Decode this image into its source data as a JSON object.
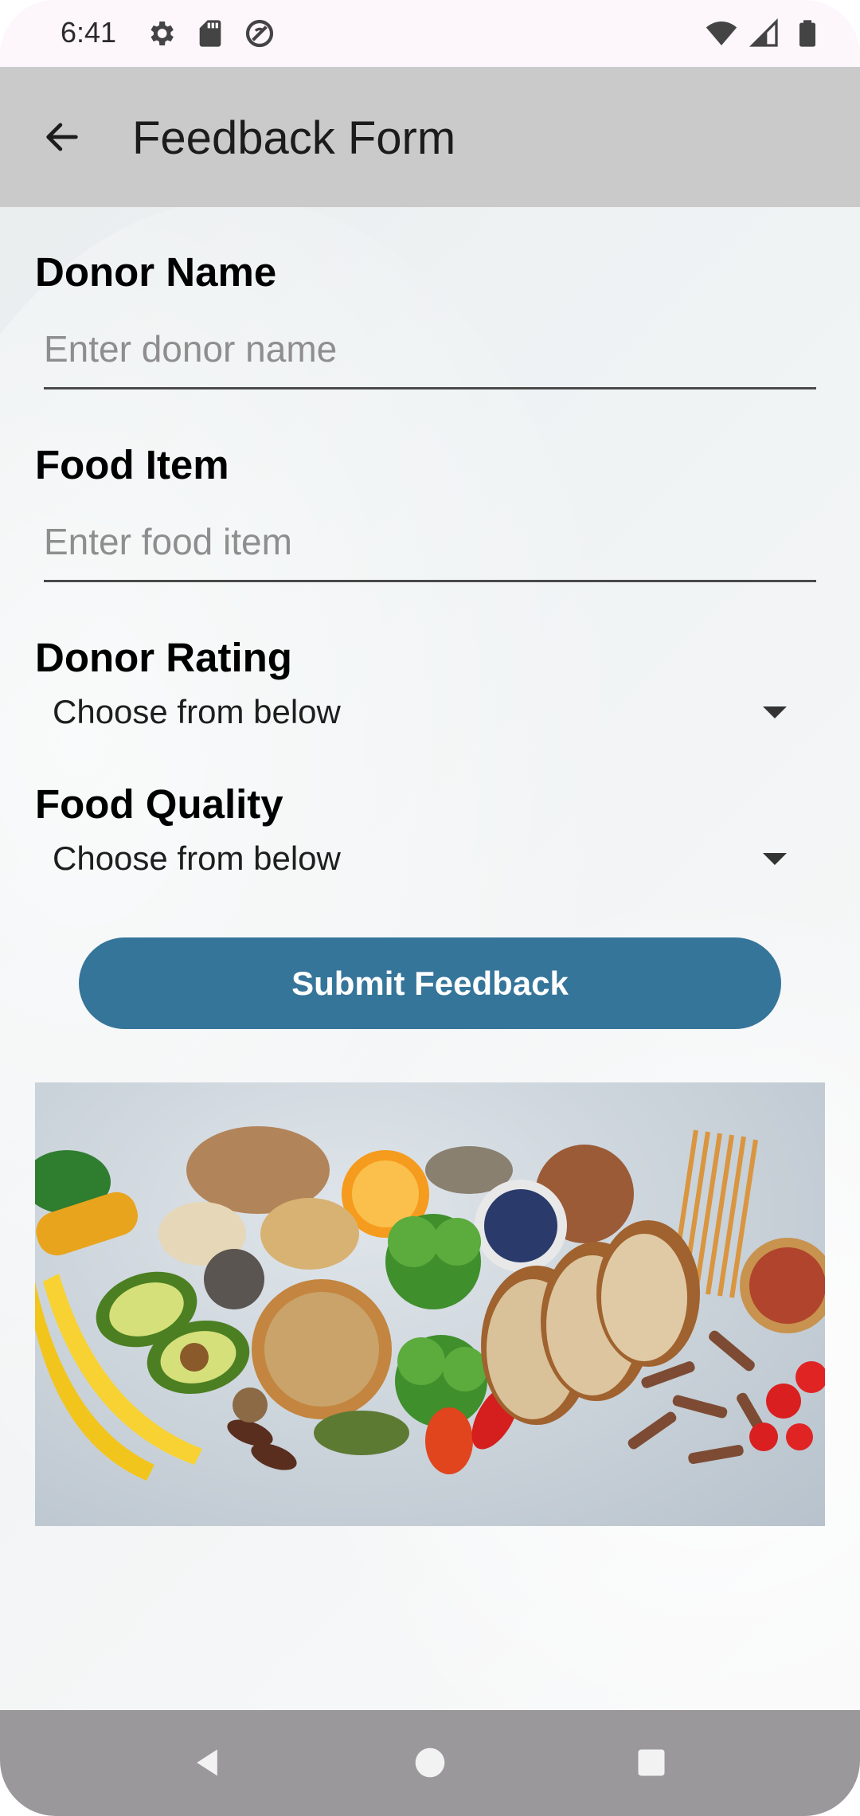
{
  "status_bar": {
    "time": "6:41",
    "left_icons": [
      "gear-icon",
      "sd-card-icon",
      "do-not-disturb-icon"
    ],
    "right_icons": [
      "wifi-icon",
      "signal-icon",
      "battery-icon"
    ]
  },
  "app_bar": {
    "title": "Feedback Form",
    "back_icon": "arrow-left-icon"
  },
  "form": {
    "donor_name": {
      "label": "Donor Name",
      "placeholder": "Enter donor name",
      "value": ""
    },
    "food_item": {
      "label": "Food Item",
      "placeholder": "Enter food item",
      "value": ""
    },
    "donor_rating": {
      "label": "Donor Rating",
      "selected": "Choose from below"
    },
    "food_quality": {
      "label": "Food Quality",
      "selected": "Choose from below"
    },
    "submit_label": "Submit Feedback"
  },
  "image": {
    "subject": "assorted healthy foods: bread, pasta, broccoli, avocado, bananas, beans, tomatoes"
  },
  "colors": {
    "accent": "#36759a",
    "app_bar": "#cacaca",
    "status_bar": "#fdf6fb",
    "nav_bar": "#9b989c"
  },
  "nav_bar": {
    "icons": [
      "back-triangle-icon",
      "home-circle-icon",
      "recents-square-icon"
    ]
  }
}
